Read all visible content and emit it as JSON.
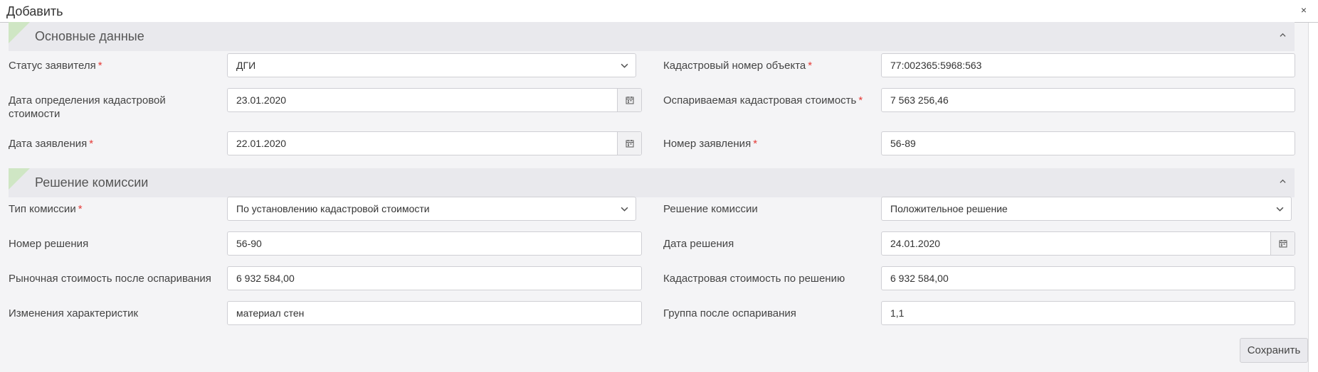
{
  "dialog": {
    "title": "Добавить",
    "close_glyph": "×"
  },
  "sections": {
    "main": {
      "title": "Основные данные"
    },
    "decision": {
      "title": "Решение комиссии"
    }
  },
  "required_mark": "*",
  "fields": {
    "applicant_status": {
      "label": "Статус заявителя",
      "value": "ДГИ"
    },
    "cadastral_number": {
      "label": "Кадастровый номер объекта",
      "value": "77:002365:5968:563"
    },
    "cadastral_date": {
      "label": "Дата определения кадастровой стоимости",
      "value": "23.01.2020"
    },
    "disputed_value": {
      "label": "Оспариваемая кадастровая стоимость",
      "value": "7 563 256,46"
    },
    "application_date": {
      "label": "Дата заявления",
      "value": "22.01.2020"
    },
    "application_number": {
      "label": "Номер заявления",
      "value": "56-89"
    },
    "commission_type": {
      "label": "Тип комиссии",
      "value": "По установлению кадастровой стоимости"
    },
    "commission_decision": {
      "label": "Решение комиссии",
      "value": "Положительное решение"
    },
    "decision_number": {
      "label": "Номер решения",
      "value": "56-90"
    },
    "decision_date": {
      "label": "Дата решения",
      "value": "24.01.2020"
    },
    "market_value": {
      "label": "Рыночная стоимость после оспаривания",
      "value": "6 932 584,00"
    },
    "cadastral_value_by_decision": {
      "label": "Кадастровая стоимость по решению",
      "value": "6 932 584,00"
    },
    "characteristics_changes": {
      "label": "Изменения характеристик",
      "value": "материал стен"
    },
    "group_after_dispute": {
      "label": "Группа после оспаривания",
      "value": "1,1"
    }
  },
  "buttons": {
    "save": "Сохранить"
  },
  "icons": {
    "close": "close-icon",
    "chevron_up": "chevron-up-icon",
    "chevron_down": "chevron-down-icon",
    "calendar": "calendar-icon"
  },
  "colors": {
    "required": "#e53935",
    "section_accent": "#cfe6c4",
    "section_bg": "#e9e9ed"
  }
}
